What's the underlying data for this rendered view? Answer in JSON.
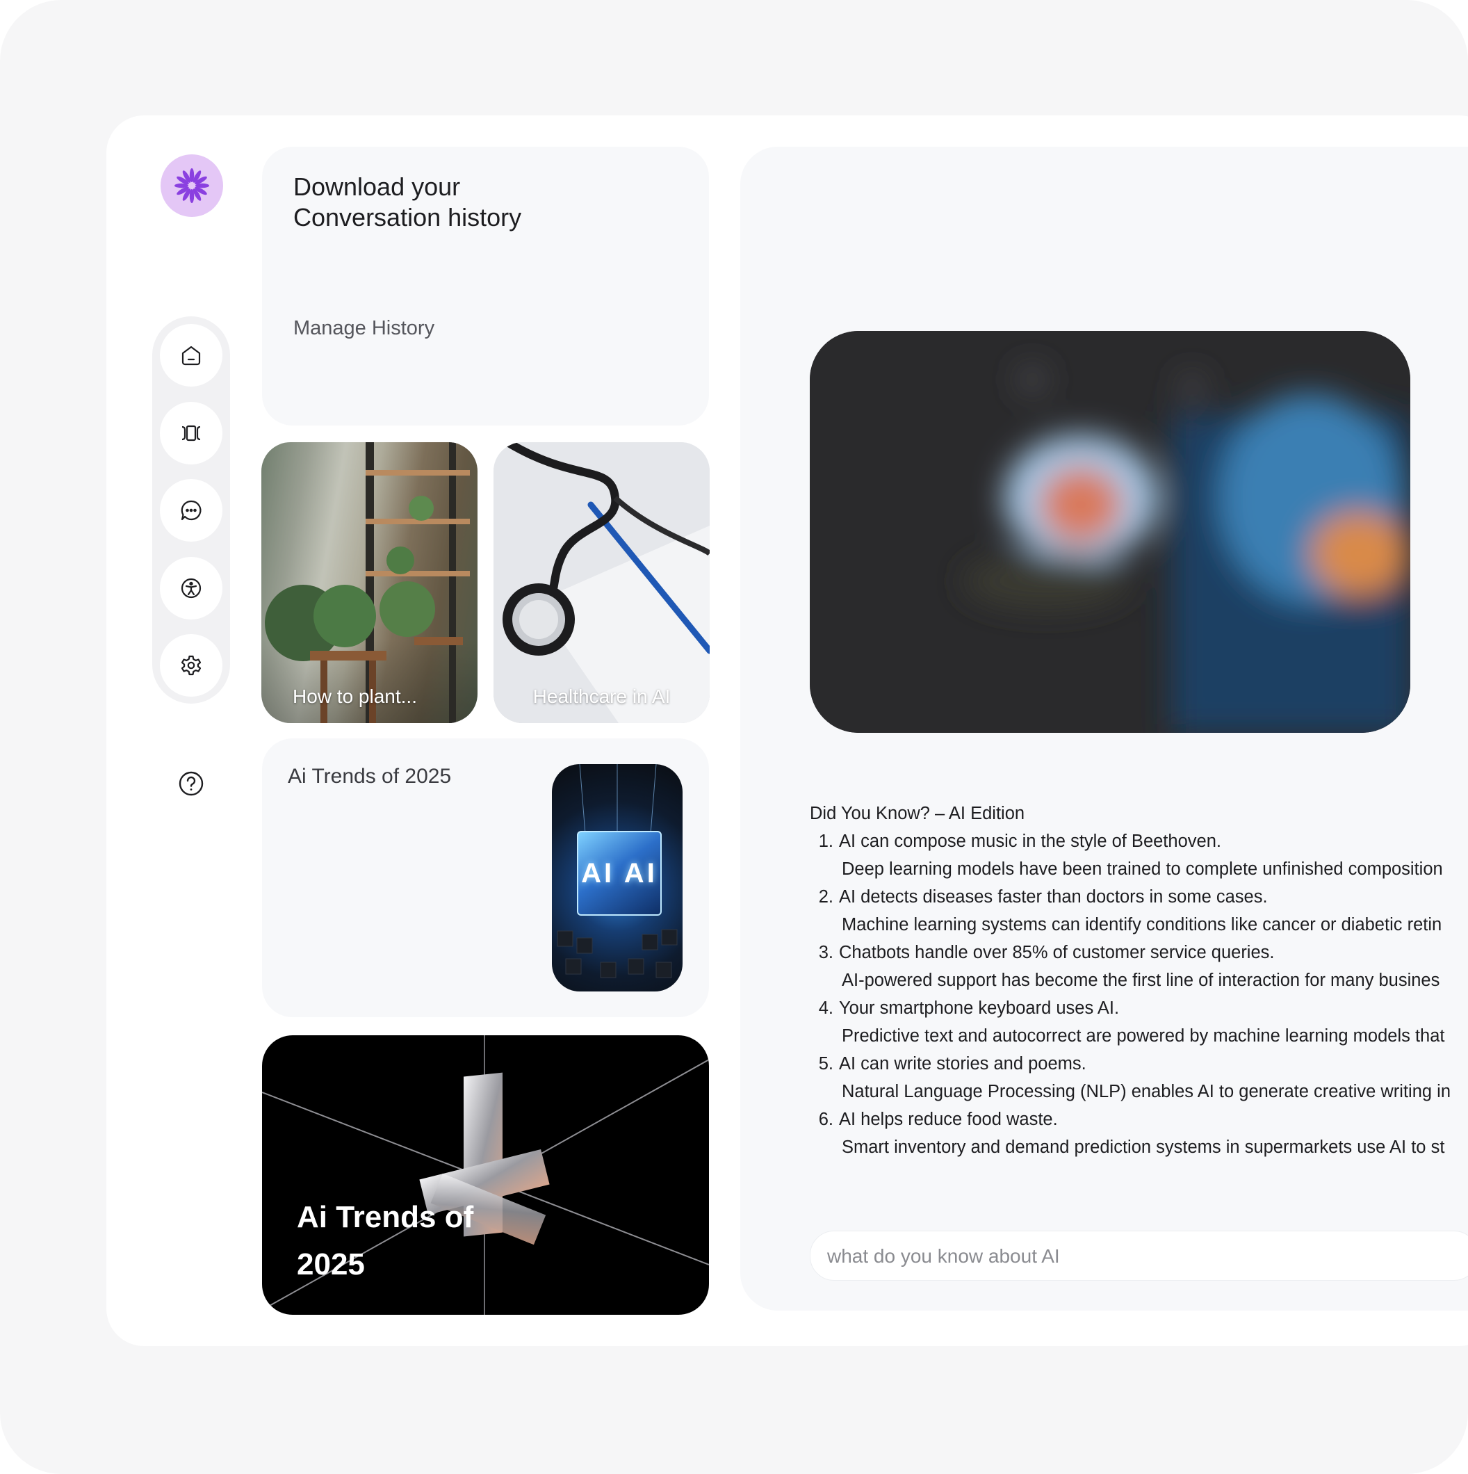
{
  "history": {
    "title": "Download your Conversation history",
    "link": "Manage History"
  },
  "cards": {
    "plant_caption": "How to plant...",
    "health_caption": "Healthcare in AI",
    "trends_title": "Ai Trends of 2025",
    "ai_thumb_text": "AI AI",
    "promo_title": "Ai Trends of 2025"
  },
  "facts": {
    "heading": "Did You Know? – AI Edition",
    "items": [
      {
        "n": "1.",
        "title": "AI can compose music in the style of Beethoven.",
        "detail": "Deep learning models have been trained to complete unfinished composition"
      },
      {
        "n": "2.",
        "title": "AI detects diseases faster than doctors in some cases.",
        "detail": "Machine learning systems can identify conditions like cancer or diabetic retin"
      },
      {
        "n": "3.",
        "title": "Chatbots handle over 85% of customer service queries.",
        "detail": "AI-powered support has become the first line of interaction for many busines"
      },
      {
        "n": "4.",
        "title": "Your smartphone keyboard uses AI.",
        "detail": "Predictive text and autocorrect are powered by machine learning models that"
      },
      {
        "n": "5.",
        "title": "AI can write stories and poems.",
        "detail": "Natural Language Processing (NLP) enables AI to generate creative writing in"
      },
      {
        "n": "6.",
        "title": "AI helps reduce food waste.",
        "detail": "Smart inventory and demand prediction systems in supermarkets use AI to st"
      }
    ]
  },
  "search": {
    "value": "",
    "placeholder": "what do you know about AI"
  },
  "icons": {
    "logo": "flower-logo-icon",
    "rail": [
      "home-icon",
      "carousel-icon",
      "chat-bubble-icon",
      "accessibility-icon",
      "gear-icon"
    ],
    "help": "question-mark-icon"
  },
  "colors": {
    "accent": "#8a3fe0",
    "logo_bg": "#e4c7f6"
  }
}
